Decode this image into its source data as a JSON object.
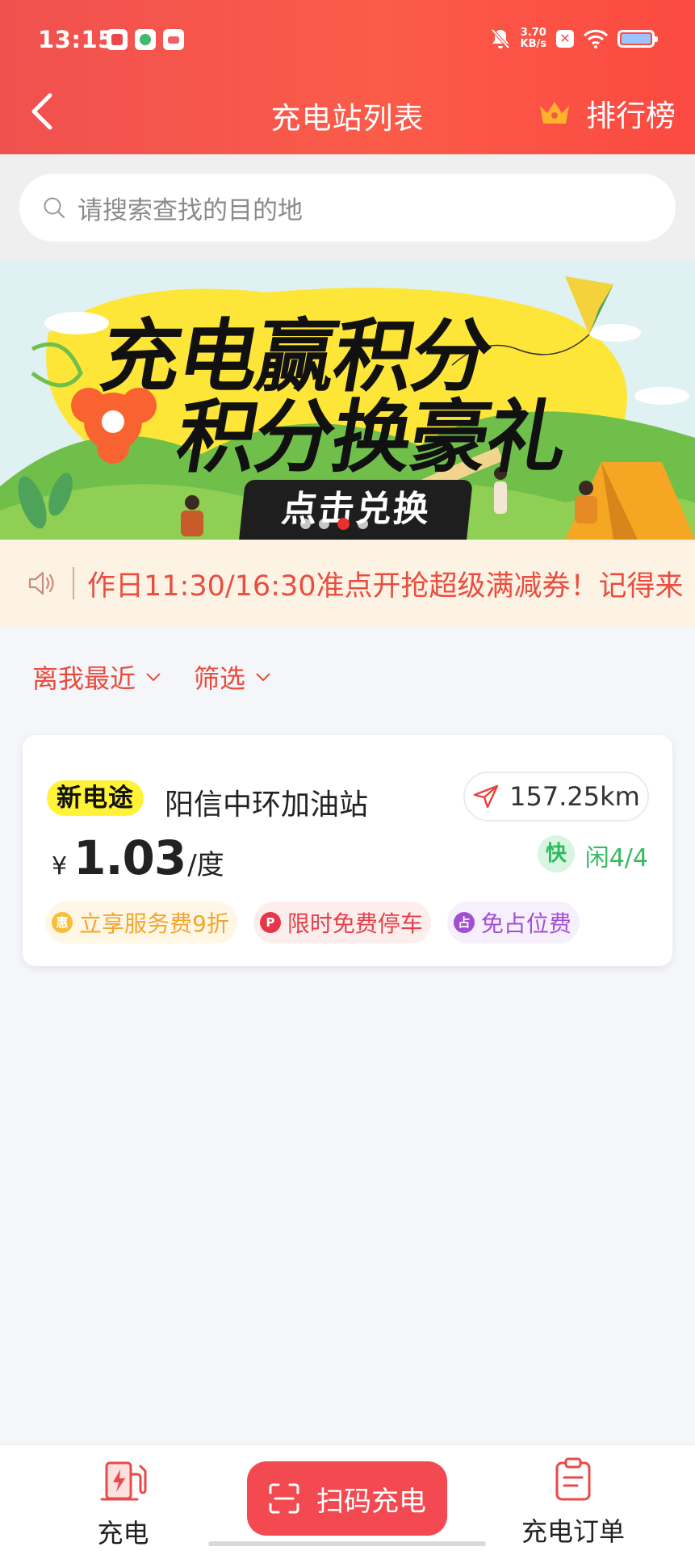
{
  "status_bar": {
    "time": "13:15",
    "net_speed_value": "3.70",
    "net_speed_unit": "KB/s",
    "icons": [
      "app-icon-red",
      "app-icon-green",
      "app-icon-box",
      "bell-off-icon",
      "close-box-icon",
      "wifi-icon",
      "battery-icon"
    ]
  },
  "nav": {
    "title": "充电站列表",
    "rank_label": "排行榜",
    "back_icon": "chevron-left-icon",
    "rank_icon": "crown-icon"
  },
  "search": {
    "placeholder": "请搜索查找的目的地"
  },
  "banner": {
    "line1": "充电赢积分",
    "line2": "积分换豪礼",
    "button_label": "点击兑换",
    "dot_count": 4,
    "active_dot": 2
  },
  "notice": {
    "text": "作日11:30/16:30准点开抢超级满减券！记得来"
  },
  "sort": {
    "nearest_label": "离我最近",
    "filter_label": "筛选"
  },
  "stations": [
    {
      "brand": "新电途",
      "name": "阳信中环加油站",
      "distance": "157.25km",
      "price_currency": "¥",
      "price_value": "1.03",
      "price_unit": "/度",
      "fast_label": "快",
      "idle_label": "闲4/4",
      "tags": [
        {
          "icon": "惠",
          "label": "立享服务费9折"
        },
        {
          "icon": "P",
          "label": "限时免费停车"
        },
        {
          "icon": "占",
          "label": "免占位费"
        }
      ]
    }
  ],
  "tabbar": {
    "charge_label": "充电",
    "scan_label": "扫码充电",
    "orders_label": "充电订单"
  },
  "colors": {
    "header_red": "#f0514f",
    "accent_red": "#e94b3c",
    "scan_button": "#f34a52",
    "idle_green": "#35bb61",
    "notice_bg": "#fdf3e4"
  }
}
